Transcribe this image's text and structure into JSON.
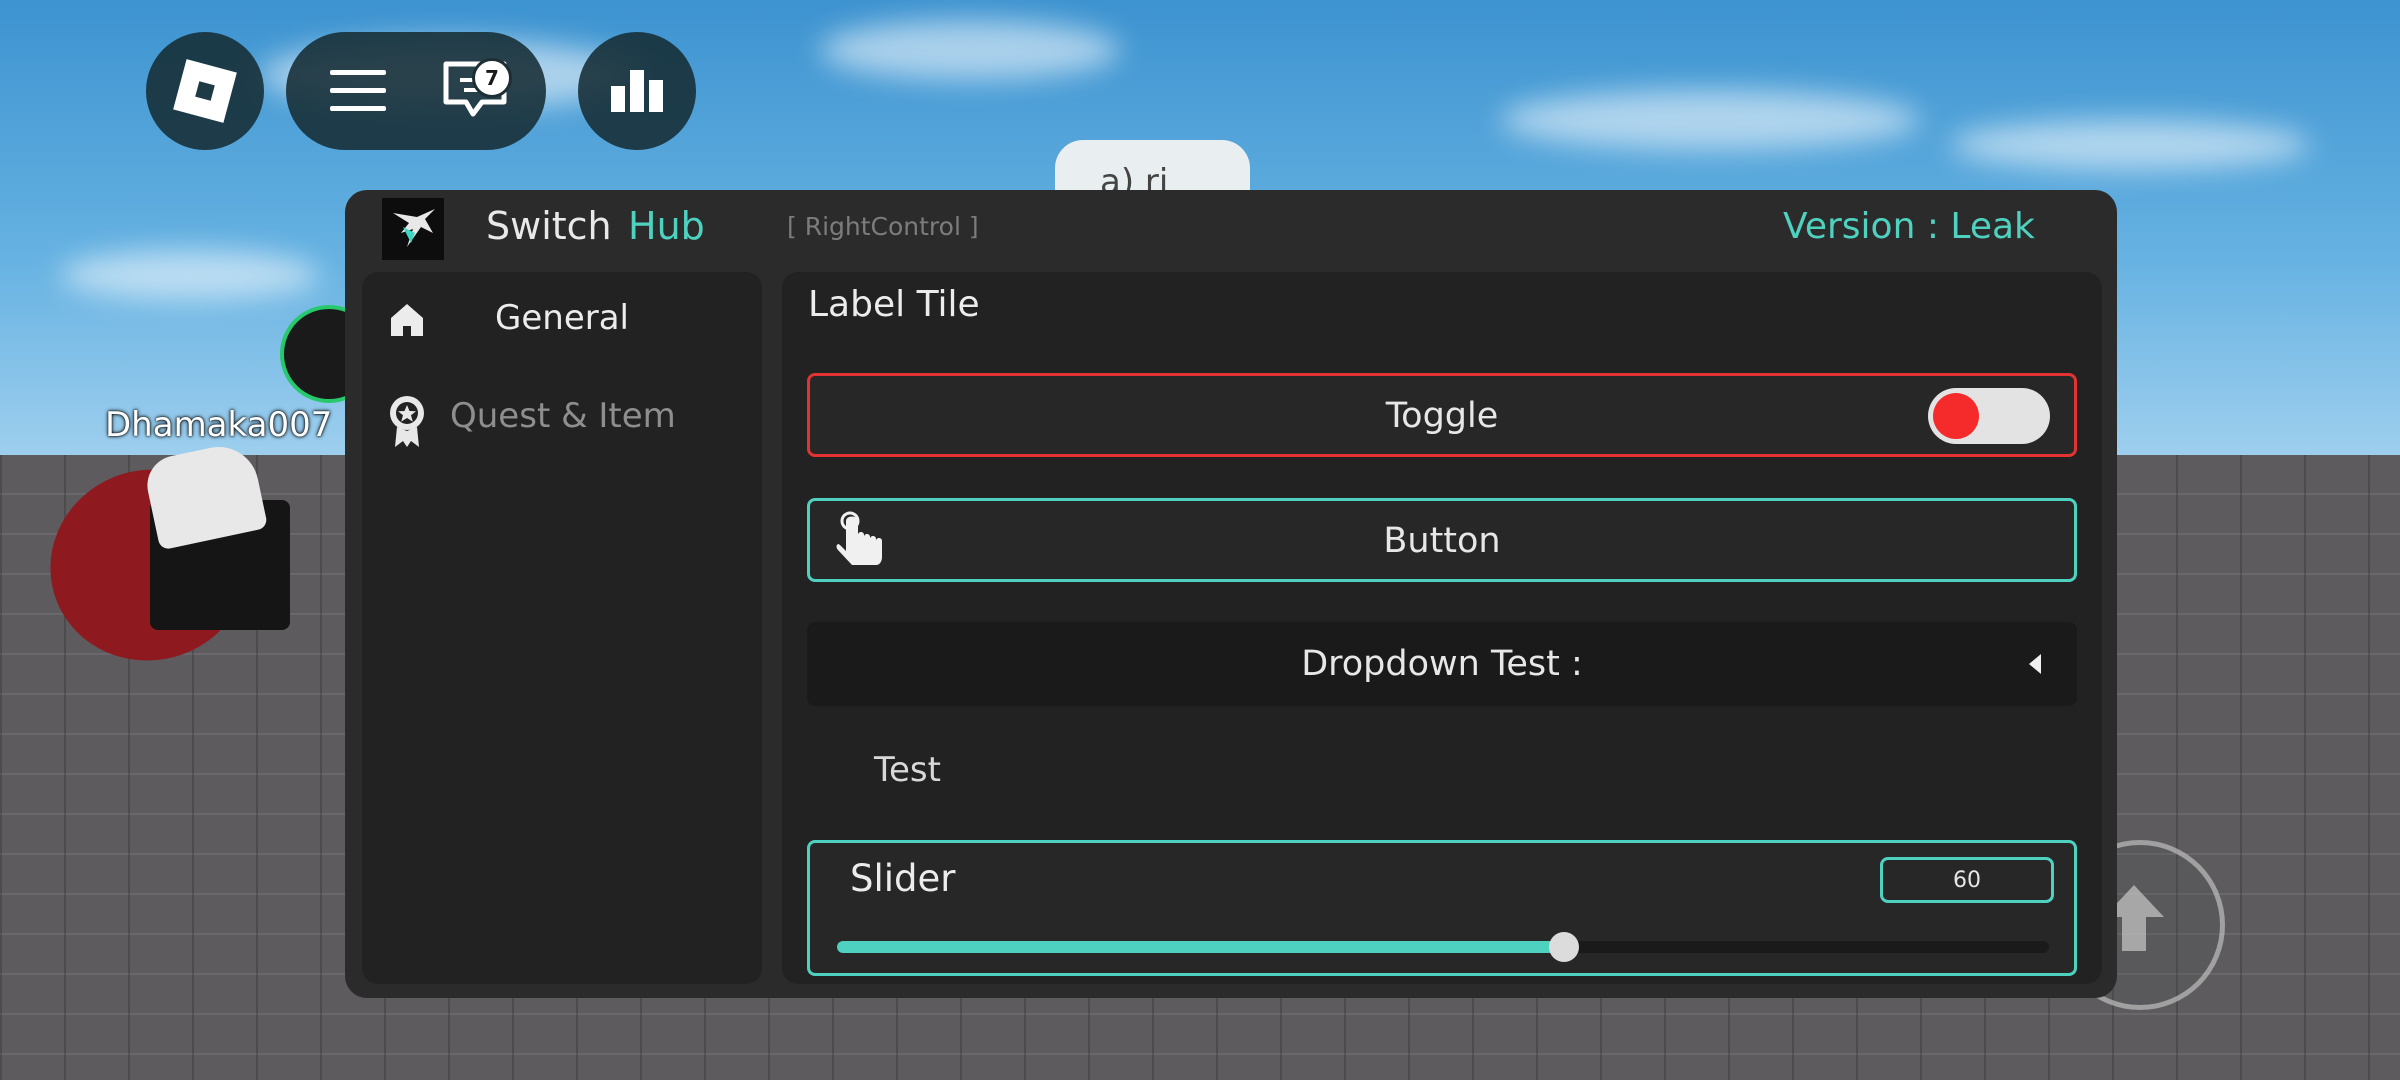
{
  "colors": {
    "accent": "#4fd1c0",
    "toggle_border": "#e23232",
    "toggle_knob": "#f52b2b",
    "window_bg": "#2b2b2b",
    "panel_bg": "#222222"
  },
  "topbar": {
    "chat_badge": "7",
    "icons": [
      "roblox-logo-icon",
      "menu-icon",
      "chat-icon",
      "leaderboard-icon"
    ]
  },
  "world": {
    "player_name": "Dhamaka007",
    "chat_bubble": "a) ri"
  },
  "window": {
    "title": "Switch",
    "title_accent": "Hub",
    "keybind": "[ RightControl ]",
    "version": "Version : Leak"
  },
  "sidebar": {
    "items": [
      {
        "label": "General",
        "icon": "home-icon",
        "active": true
      },
      {
        "label": "Quest & Item",
        "icon": "medal-icon",
        "active": false
      }
    ]
  },
  "main": {
    "section_title": "Label Tile",
    "toggle": {
      "label": "Toggle",
      "state": "off"
    },
    "button": {
      "label": "Button",
      "icon": "hand-pointer-icon"
    },
    "dropdown": {
      "label": "Dropdown Test :",
      "icon": "caret-left-icon"
    },
    "label": {
      "text": "Test"
    },
    "slider": {
      "label": "Slider",
      "value": "60",
      "fraction": 0.6
    }
  }
}
